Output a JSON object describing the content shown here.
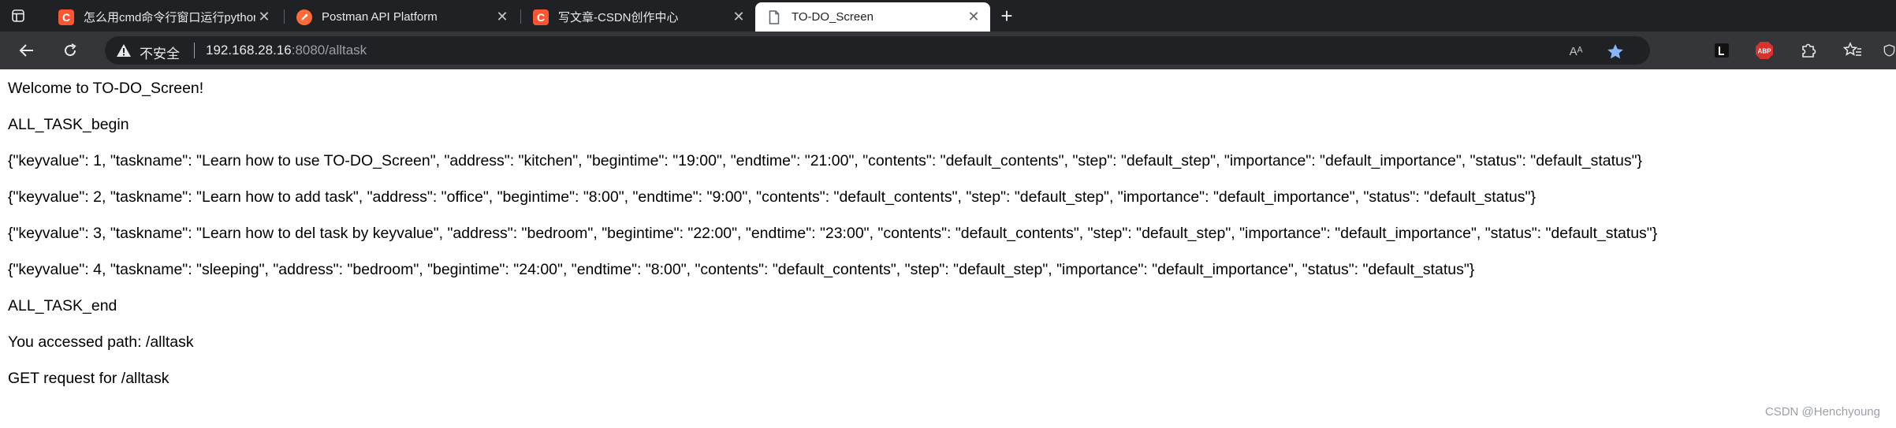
{
  "browser": {
    "tabs": [
      {
        "title": "怎么用cmd命令行窗口运行python",
        "favicon": "csdn-icon",
        "active": false
      },
      {
        "title": "Postman API Platform",
        "favicon": "postman-icon",
        "active": false
      },
      {
        "title": "写文章-CSDN创作中心",
        "favicon": "csdn-icon",
        "active": false
      },
      {
        "title": "TO-DO_Screen",
        "favicon": "document-icon",
        "active": true
      }
    ],
    "address_bar": {
      "security_label": "不安全",
      "url_host": "192.168.28.16",
      "url_rest": ":8080/alltask"
    },
    "reader_label": "Aᴬ",
    "extensions": [
      {
        "name": "L",
        "color": "#1f1f1f"
      },
      {
        "name": "ABP",
        "color": "#e53935"
      }
    ]
  },
  "page": {
    "lines": [
      "Welcome to TO-DO_Screen!",
      "ALL_TASK_begin",
      "{\"keyvalue\": 1, \"taskname\": \"Learn how to use TO-DO_Screen\", \"address\": \"kitchen\", \"begintime\": \"19:00\", \"endtime\": \"21:00\", \"contents\": \"default_contents\", \"step\": \"default_step\", \"importance\": \"default_importance\", \"status\": \"default_status\"}",
      "{\"keyvalue\": 2, \"taskname\": \"Learn how to add task\", \"address\": \"office\", \"begintime\": \"8:00\", \"endtime\": \"9:00\", \"contents\": \"default_contents\", \"step\": \"default_step\", \"importance\": \"default_importance\", \"status\": \"default_status\"}",
      "{\"keyvalue\": 3, \"taskname\": \"Learn how to del task by keyvalue\", \"address\": \"bedroom\", \"begintime\": \"22:00\", \"endtime\": \"23:00\", \"contents\": \"default_contents\", \"step\": \"default_step\", \"importance\": \"default_importance\", \"status\": \"default_status\"}",
      "{\"keyvalue\": 4, \"taskname\": \"sleeping\", \"address\": \"bedroom\", \"begintime\": \"24:00\", \"endtime\": \"8:00\", \"contents\": \"default_contents\", \"step\": \"default_step\", \"importance\": \"default_importance\", \"status\": \"default_status\"}",
      "ALL_TASK_end",
      "You accessed path: /alltask",
      "GET request for /alltask"
    ],
    "watermark": "CSDN @Henchyoung"
  },
  "colors": {
    "tabstrip_bg": "#202124",
    "toolbar_bg": "#35363a",
    "omnibox_bg": "#202124",
    "csdn_brand": "#fc5531",
    "postman_brand": "#ff6c37",
    "star_blue": "#8ab4f8"
  }
}
